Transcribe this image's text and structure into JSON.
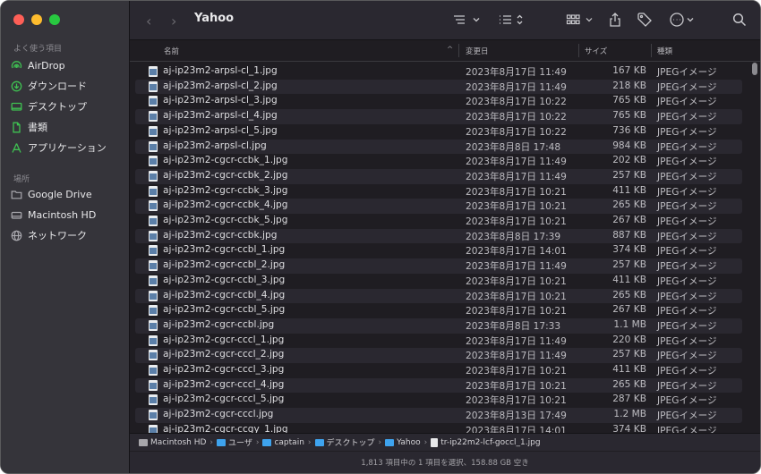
{
  "window": {
    "title": "Yahoo"
  },
  "sidebar": {
    "favorites_title": "よく使う項目",
    "favorites": [
      {
        "label": "AirDrop",
        "icon": "airdrop-icon"
      },
      {
        "label": "ダウンロード",
        "icon": "download-icon"
      },
      {
        "label": "デスクトップ",
        "icon": "desktop-icon"
      },
      {
        "label": "書類",
        "icon": "document-icon"
      },
      {
        "label": "アプリケーション",
        "icon": "applications-icon"
      }
    ],
    "locations_title": "場所",
    "locations": [
      {
        "label": "Google Drive",
        "icon": "folder-icon"
      },
      {
        "label": "Macintosh HD",
        "icon": "disk-icon"
      },
      {
        "label": "ネットワーク",
        "icon": "globe-icon"
      }
    ]
  },
  "columns": {
    "name": "名前",
    "date": "変更日",
    "size": "サイズ",
    "kind": "種類"
  },
  "files": [
    {
      "name": "aj-ip23m2-arpsl-cl_1.jpg",
      "date": "2023年8月17日 11:49",
      "size": "167 KB",
      "kind": "JPEGイメージ"
    },
    {
      "name": "aj-ip23m2-arpsl-cl_2.jpg",
      "date": "2023年8月17日 11:49",
      "size": "218 KB",
      "kind": "JPEGイメージ"
    },
    {
      "name": "aj-ip23m2-arpsl-cl_3.jpg",
      "date": "2023年8月17日 10:22",
      "size": "765 KB",
      "kind": "JPEGイメージ"
    },
    {
      "name": "aj-ip23m2-arpsl-cl_4.jpg",
      "date": "2023年8月17日 10:22",
      "size": "765 KB",
      "kind": "JPEGイメージ"
    },
    {
      "name": "aj-ip23m2-arpsl-cl_5.jpg",
      "date": "2023年8月17日 10:22",
      "size": "736 KB",
      "kind": "JPEGイメージ"
    },
    {
      "name": "aj-ip23m2-arpsl-cl.jpg",
      "date": "2023年8月8日 17:48",
      "size": "984 KB",
      "kind": "JPEGイメージ"
    },
    {
      "name": "aj-ip23m2-cgcr-ccbk_1.jpg",
      "date": "2023年8月17日 11:49",
      "size": "202 KB",
      "kind": "JPEGイメージ"
    },
    {
      "name": "aj-ip23m2-cgcr-ccbk_2.jpg",
      "date": "2023年8月17日 11:49",
      "size": "257 KB",
      "kind": "JPEGイメージ"
    },
    {
      "name": "aj-ip23m2-cgcr-ccbk_3.jpg",
      "date": "2023年8月17日 10:21",
      "size": "411 KB",
      "kind": "JPEGイメージ"
    },
    {
      "name": "aj-ip23m2-cgcr-ccbk_4.jpg",
      "date": "2023年8月17日 10:21",
      "size": "265 KB",
      "kind": "JPEGイメージ"
    },
    {
      "name": "aj-ip23m2-cgcr-ccbk_5.jpg",
      "date": "2023年8月17日 10:21",
      "size": "267 KB",
      "kind": "JPEGイメージ"
    },
    {
      "name": "aj-ip23m2-cgcr-ccbk.jpg",
      "date": "2023年8月8日 17:39",
      "size": "887 KB",
      "kind": "JPEGイメージ"
    },
    {
      "name": "aj-ip23m2-cgcr-ccbl_1.jpg",
      "date": "2023年8月17日 14:01",
      "size": "374 KB",
      "kind": "JPEGイメージ"
    },
    {
      "name": "aj-ip23m2-cgcr-ccbl_2.jpg",
      "date": "2023年8月17日 11:49",
      "size": "257 KB",
      "kind": "JPEGイメージ"
    },
    {
      "name": "aj-ip23m2-cgcr-ccbl_3.jpg",
      "date": "2023年8月17日 10:21",
      "size": "411 KB",
      "kind": "JPEGイメージ"
    },
    {
      "name": "aj-ip23m2-cgcr-ccbl_4.jpg",
      "date": "2023年8月17日 10:21",
      "size": "265 KB",
      "kind": "JPEGイメージ"
    },
    {
      "name": "aj-ip23m2-cgcr-ccbl_5.jpg",
      "date": "2023年8月17日 10:21",
      "size": "267 KB",
      "kind": "JPEGイメージ"
    },
    {
      "name": "aj-ip23m2-cgcr-ccbl.jpg",
      "date": "2023年8月8日 17:33",
      "size": "1.1 MB",
      "kind": "JPEGイメージ"
    },
    {
      "name": "aj-ip23m2-cgcr-cccl_1.jpg",
      "date": "2023年8月17日 11:49",
      "size": "220 KB",
      "kind": "JPEGイメージ"
    },
    {
      "name": "aj-ip23m2-cgcr-cccl_2.jpg",
      "date": "2023年8月17日 11:49",
      "size": "257 KB",
      "kind": "JPEGイメージ"
    },
    {
      "name": "aj-ip23m2-cgcr-cccl_3.jpg",
      "date": "2023年8月17日 10:21",
      "size": "411 KB",
      "kind": "JPEGイメージ"
    },
    {
      "name": "aj-ip23m2-cgcr-cccl_4.jpg",
      "date": "2023年8月17日 10:21",
      "size": "265 KB",
      "kind": "JPEGイメージ"
    },
    {
      "name": "aj-ip23m2-cgcr-cccl_5.jpg",
      "date": "2023年8月17日 10:21",
      "size": "287 KB",
      "kind": "JPEGイメージ"
    },
    {
      "name": "aj-ip23m2-cgcr-cccl.jpg",
      "date": "2023年8月13日 17:49",
      "size": "1.2 MB",
      "kind": "JPEGイメージ"
    },
    {
      "name": "aj-ip23m2-cgcr-ccgy_1.jpg",
      "date": "2023年8月17日 14:01",
      "size": "374 KB",
      "kind": "JPEGイメージ"
    }
  ],
  "pathbar": [
    {
      "label": "Macintosh HD",
      "icon": "disk-icon"
    },
    {
      "label": "ユーザ",
      "icon": "folder-icon"
    },
    {
      "label": "captain",
      "icon": "folder-icon"
    },
    {
      "label": "デスクトップ",
      "icon": "folder-icon"
    },
    {
      "label": "Yahoo",
      "icon": "folder-icon"
    },
    {
      "label": "tr-ip22m2-lcf-goccl_1.jpg",
      "icon": "file-icon"
    }
  ],
  "status": "1,813 項目中の 1 項目を選択、158.88 GB 空き",
  "colors": {
    "accent": "#3fc152",
    "folder": "#3ea3ee"
  }
}
